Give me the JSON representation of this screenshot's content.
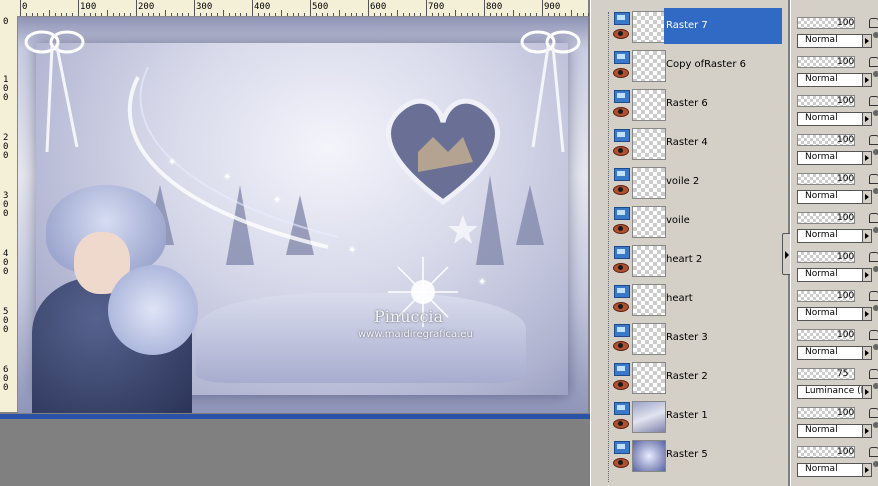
{
  "ruler": {
    "top_labels": [
      "0",
      "100",
      "200",
      "300",
      "400",
      "500",
      "600",
      "700",
      "800",
      "900"
    ],
    "left_labels": [
      "0",
      "1 0 0",
      "2 0 0",
      "3 0 0",
      "4 0 0",
      "5 0 0",
      "6 0 0"
    ]
  },
  "canvas": {
    "watermark": "Pinuccia",
    "watermark_url": "www.maidiregrafica.eu"
  },
  "layers": [
    {
      "name": "Raster 7",
      "selected": true,
      "thumb": "transparent",
      "opacity": "100",
      "blend": "Normal"
    },
    {
      "name": "Copy ofRaster 6",
      "selected": false,
      "thumb": "transparent",
      "opacity": "100",
      "blend": "Normal"
    },
    {
      "name": "Raster 6",
      "selected": false,
      "thumb": "transparent",
      "opacity": "100",
      "blend": "Normal"
    },
    {
      "name": "Raster 4",
      "selected": false,
      "thumb": "transparent",
      "opacity": "100",
      "blend": "Normal"
    },
    {
      "name": "voile 2",
      "selected": false,
      "thumb": "transparent",
      "opacity": "100",
      "blend": "Normal"
    },
    {
      "name": "voile",
      "selected": false,
      "thumb": "transparent",
      "opacity": "100",
      "blend": "Normal"
    },
    {
      "name": "heart 2",
      "selected": false,
      "thumb": "transparent",
      "opacity": "100",
      "blend": "Normal"
    },
    {
      "name": "heart",
      "selected": false,
      "thumb": "transparent",
      "opacity": "100",
      "blend": "Normal"
    },
    {
      "name": "Raster 3",
      "selected": false,
      "thumb": "transparent",
      "opacity": "100",
      "blend": "Normal"
    },
    {
      "name": "Raster 2",
      "selected": false,
      "thumb": "transparent",
      "opacity": "75",
      "blend": "Luminance (L)"
    },
    {
      "name": "Raster 1",
      "selected": false,
      "thumb": "photo",
      "opacity": "100",
      "blend": "Normal"
    },
    {
      "name": "Raster 5",
      "selected": false,
      "thumb": "dark",
      "opacity": "100",
      "blend": "Normal"
    }
  ],
  "colors": {
    "selection": "#316ac5",
    "palette_bg": "#d4d0c8",
    "workspace": "#808080"
  }
}
